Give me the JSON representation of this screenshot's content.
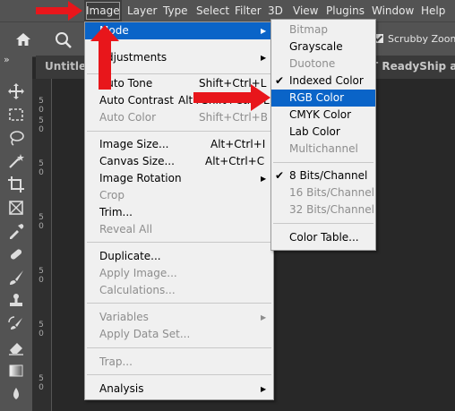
{
  "menubar": {
    "items": [
      {
        "label": "Image",
        "active": true
      },
      {
        "label": "Layer"
      },
      {
        "label": "Type"
      },
      {
        "label": "Select"
      },
      {
        "label": "Filter"
      },
      {
        "label": "3D"
      },
      {
        "label": "View"
      },
      {
        "label": "Plugins"
      },
      {
        "label": "Window"
      },
      {
        "label": "Help"
      }
    ]
  },
  "options": {
    "scrubby_zoom_label": "Scrubby Zoom",
    "scrubby_checked": true
  },
  "tabs": {
    "doc1": "Untitled",
    "doc2": "T ReadyShip arro"
  },
  "ruler": {
    "marks": [
      "5",
      "0",
      "5",
      "0",
      "5",
      "0",
      "5",
      "0",
      "5",
      "0",
      "5",
      "0",
      "5",
      "0",
      "5",
      "0"
    ]
  },
  "image_menu": {
    "items": [
      {
        "label": "Mode",
        "submenu": true
      },
      {
        "label": "Adjustments",
        "submenu": true
      },
      {
        "label": "Auto Tone",
        "shortcut": "Shift+Ctrl+L"
      },
      {
        "label": "Auto Contrast",
        "shortcut": "Alt+Shift+Ctrl+L"
      },
      {
        "label": "Auto Color",
        "shortcut": "Shift+Ctrl+B",
        "disabled": true
      },
      {
        "label": "Image Size...",
        "shortcut": "Alt+Ctrl+I"
      },
      {
        "label": "Canvas Size...",
        "shortcut": "Alt+Ctrl+C"
      },
      {
        "label": "Image Rotation",
        "submenu": true
      },
      {
        "label": "Crop",
        "disabled": true
      },
      {
        "label": "Trim..."
      },
      {
        "label": "Reveal All",
        "disabled": true
      },
      {
        "label": "Duplicate..."
      },
      {
        "label": "Apply Image...",
        "disabled": true
      },
      {
        "label": "Calculations...",
        "disabled": true
      },
      {
        "label": "Variables",
        "submenu": true,
        "disabled": true
      },
      {
        "label": "Apply Data Set...",
        "disabled": true
      },
      {
        "label": "Trap...",
        "disabled": true
      },
      {
        "label": "Analysis",
        "submenu": true
      }
    ]
  },
  "mode_menu": {
    "items": [
      {
        "label": "Bitmap",
        "disabled": true
      },
      {
        "label": "Grayscale"
      },
      {
        "label": "Duotone",
        "disabled": true
      },
      {
        "label": "Indexed Color",
        "checked": true
      },
      {
        "label": "RGB Color",
        "highlighted": true
      },
      {
        "label": "CMYK Color"
      },
      {
        "label": "Lab Color"
      },
      {
        "label": "Multichannel",
        "disabled": true
      },
      {
        "label": "8 Bits/Channel",
        "checked": true
      },
      {
        "label": "16 Bits/Channel",
        "disabled": true
      },
      {
        "label": "32 Bits/Channel",
        "disabled": true
      },
      {
        "label": "Color Table..."
      }
    ]
  },
  "colors": {
    "highlight": "#0a64c8",
    "annotation_arrow": "#e8161b",
    "menu_bg": "#f0f0f0",
    "app_bg": "#535353"
  }
}
